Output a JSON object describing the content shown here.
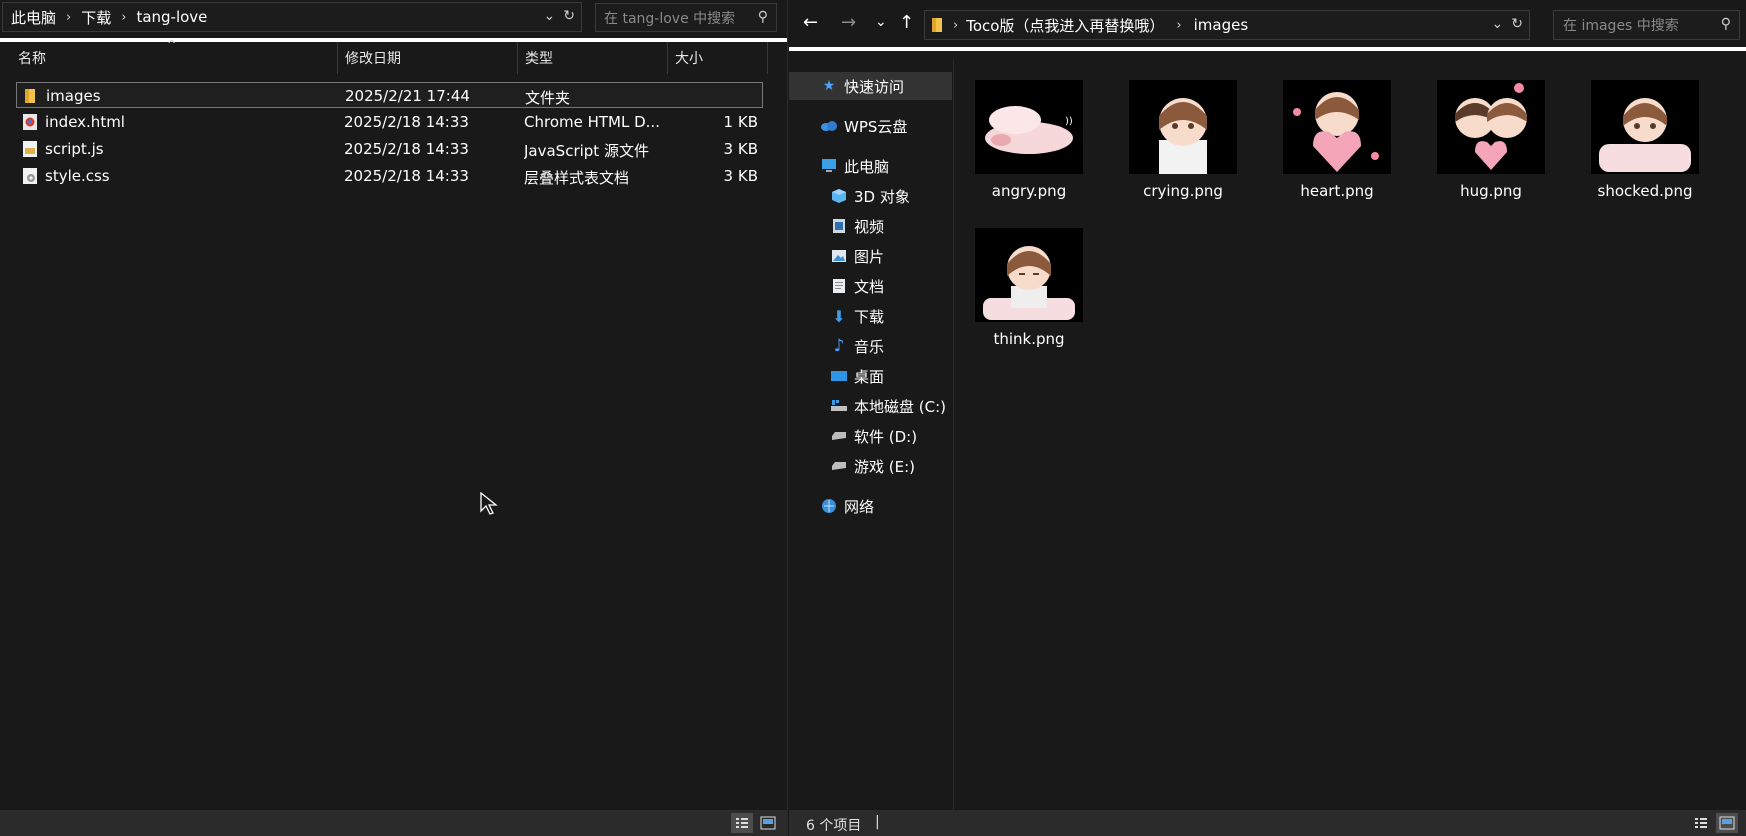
{
  "left": {
    "breadcrumb": [
      "此电脑",
      "下载",
      "tang-love"
    ],
    "search_placeholder": "在 tang-love 中搜索",
    "columns": [
      "名称",
      "修改日期",
      "类型",
      "大小"
    ],
    "rows": [
      {
        "name": "images",
        "date": "2025/2/21 17:44",
        "type": "文件夹",
        "size": "",
        "icon": "folder-icon"
      },
      {
        "name": "index.html",
        "date": "2025/2/18 14:33",
        "type": "Chrome HTML D...",
        "size": "1 KB",
        "icon": "chrome-html-icon"
      },
      {
        "name": "script.js",
        "date": "2025/2/18 14:33",
        "type": "JavaScript 源文件",
        "size": "3 KB",
        "icon": "js-file-icon"
      },
      {
        "name": "style.css",
        "date": "2025/2/18 14:33",
        "type": "层叠样式表文档",
        "size": "3 KB",
        "icon": "css-file-icon"
      }
    ]
  },
  "right": {
    "breadcrumb": [
      "Toco版（点我进入再替换哦）",
      "images"
    ],
    "search_placeholder": "在 images 中搜索",
    "tree": [
      {
        "label": "快速访问",
        "icon": "star-icon"
      },
      {
        "label": "WPS云盘",
        "icon": "cloud-icon"
      },
      {
        "label": "此电脑",
        "icon": "computer-icon"
      },
      {
        "label": "3D 对象",
        "icon": "cube-icon"
      },
      {
        "label": "视频",
        "icon": "video-icon"
      },
      {
        "label": "图片",
        "icon": "picture-icon"
      },
      {
        "label": "文档",
        "icon": "document-icon"
      },
      {
        "label": "下载",
        "icon": "download-icon"
      },
      {
        "label": "音乐",
        "icon": "music-icon"
      },
      {
        "label": "桌面",
        "icon": "desktop-icon"
      },
      {
        "label": "本地磁盘 (C:)",
        "icon": "drive-c-icon"
      },
      {
        "label": "软件 (D:)",
        "icon": "drive-icon"
      },
      {
        "label": "游戏 (E:)",
        "icon": "drive-icon"
      },
      {
        "label": "网络",
        "icon": "network-icon"
      }
    ],
    "files": [
      "angry.png",
      "crying.png",
      "heart.png",
      "hug.png",
      "shocked.png",
      "think.png"
    ],
    "status": "6 个项目"
  }
}
